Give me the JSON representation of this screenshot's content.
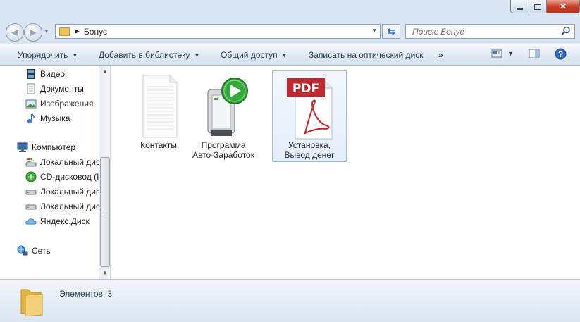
{
  "window": {
    "buttons": {
      "minimize": "minimize-icon",
      "maximize": "maximize-icon",
      "close": "close-icon"
    }
  },
  "address": {
    "path": "Бонус",
    "search_placeholder": "Поиск: Бонус"
  },
  "toolbar": {
    "organize": "Упорядочить",
    "add_library": "Добавить в библиотеку",
    "share": "Общий доступ",
    "burn": "Записать на оптический диск",
    "more": "»"
  },
  "nav": {
    "libraries": [
      {
        "label": "Видео",
        "icon": "video-icon"
      },
      {
        "label": "Документы",
        "icon": "documents-icon"
      },
      {
        "label": "Изображения",
        "icon": "pictures-icon"
      },
      {
        "label": "Музыка",
        "icon": "music-icon"
      }
    ],
    "computer": {
      "label": "Компьютер",
      "icon": "computer-icon"
    },
    "drives": [
      {
        "label": "Локальный дис",
        "icon": "system-drive-icon"
      },
      {
        "label": "CD-дисковод (I",
        "icon": "cd-drive-icon"
      },
      {
        "label": "Локальный дис",
        "icon": "drive-icon"
      },
      {
        "label": "Локальный дис",
        "icon": "drive-icon"
      },
      {
        "label": "Яндекс.Диск",
        "icon": "cloud-icon"
      }
    ],
    "network": {
      "label": "Сеть",
      "icon": "network-icon"
    }
  },
  "files": [
    {
      "name": "Контакты",
      "icon": "text-file-icon",
      "selected": false
    },
    {
      "name": "Программа Авто-Заработок",
      "line1": "Программа",
      "line2": "Авто-Заработок",
      "icon": "installer-icon",
      "selected": false
    },
    {
      "name": "Установка, Вывод денег",
      "line1": "Установка,",
      "line2": "Вывод денег",
      "icon": "pdf-icon",
      "selected": true
    }
  ],
  "status": {
    "count_text": "Элементов: 3"
  },
  "colors": {
    "toolbar_text": "#1e395b",
    "selection_border": "#9bbbe3",
    "pdf_red": "#c0272d",
    "play_green": "#34a83a"
  }
}
